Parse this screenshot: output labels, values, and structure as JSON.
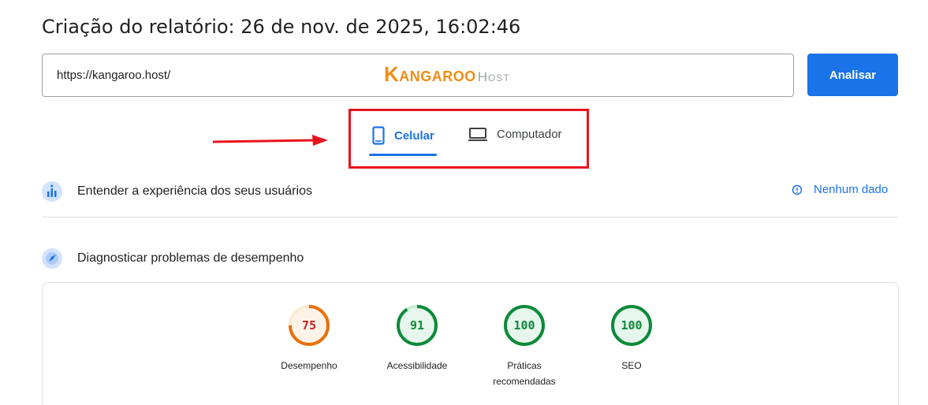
{
  "report": {
    "title": "Criação do relatório: 26 de nov. de 2025, 16:02:46"
  },
  "url_bar": {
    "value": "https://kangaroo.host/",
    "logo_main": "Kangaroo",
    "logo_sub": "Host"
  },
  "analyze_button": {
    "label": "Analisar"
  },
  "tabs": [
    {
      "label": "Celular",
      "icon": "smartphone-icon",
      "active": true
    },
    {
      "label": "Computador",
      "icon": "laptop-icon",
      "active": false
    }
  ],
  "sections": {
    "ux": {
      "label": "Entender a experiência dos seus usuários",
      "status": "Nenhum dado",
      "icon": "users-chart-icon"
    },
    "diagnose": {
      "label": "Diagnosticar problemas de desempenho",
      "icon": "lighthouse-icon"
    }
  },
  "scores": [
    {
      "label": "Desempenho",
      "value": "75",
      "fraction": 0.75,
      "color": "#e8710a",
      "track": "#fdebd6",
      "fill": "#fff3e8"
    },
    {
      "label": "Acessibilidade",
      "value": "91",
      "fraction": 0.91,
      "color": "#0c8a3a",
      "track": "#c8efd6",
      "fill": "#e6f6ec"
    },
    {
      "label": "Práticas recomendadas",
      "value": "100",
      "fraction": 1.0,
      "color": "#0c8a3a",
      "track": "#c8efd6",
      "fill": "#e6f6ec"
    },
    {
      "label": "SEO",
      "value": "100",
      "fraction": 1.0,
      "color": "#0c8a3a",
      "track": "#c8efd6",
      "fill": "#e6f6ec"
    }
  ],
  "colors": {
    "accent": "#1a73e8",
    "highlight": "#e8131a",
    "brand": "#f28c13"
  }
}
